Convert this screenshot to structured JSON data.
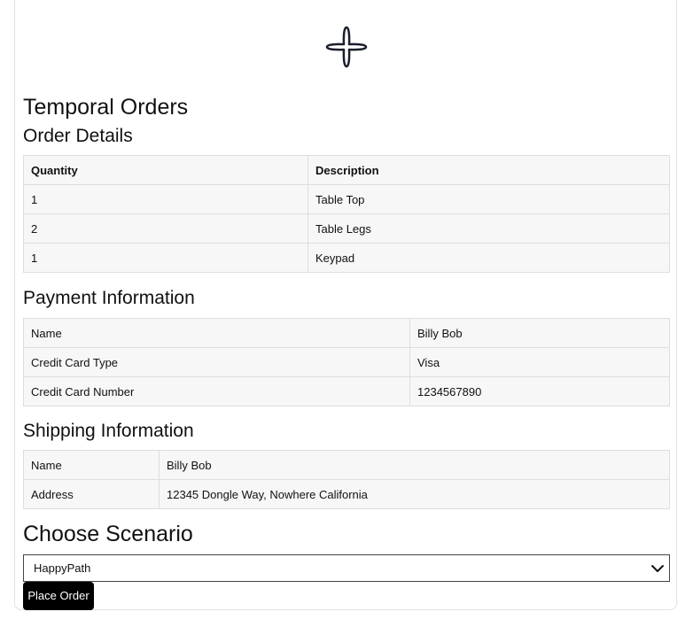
{
  "header": {
    "logo_icon": "temporal-star-icon",
    "title": "Temporal Orders"
  },
  "order_details": {
    "heading": "Order Details",
    "columns": [
      "Quantity",
      "Description"
    ],
    "rows": [
      {
        "quantity": "1",
        "description": "Table Top"
      },
      {
        "quantity": "2",
        "description": "Table Legs"
      },
      {
        "quantity": "1",
        "description": "Keypad"
      }
    ]
  },
  "payment": {
    "heading": "Payment Information",
    "rows": [
      {
        "label": "Name",
        "value": "Billy Bob"
      },
      {
        "label": "Credit Card Type",
        "value": "Visa"
      },
      {
        "label": "Credit Card Number",
        "value": "1234567890"
      }
    ]
  },
  "shipping": {
    "heading": "Shipping Information",
    "rows": [
      {
        "label": "Name",
        "value": "Billy Bob"
      },
      {
        "label": "Address",
        "value": "12345 Dongle Way, Nowhere California"
      }
    ]
  },
  "scenario": {
    "heading": "Choose Scenario",
    "selected": "HappyPath"
  },
  "actions": {
    "place_order_label": "Place Order"
  }
}
